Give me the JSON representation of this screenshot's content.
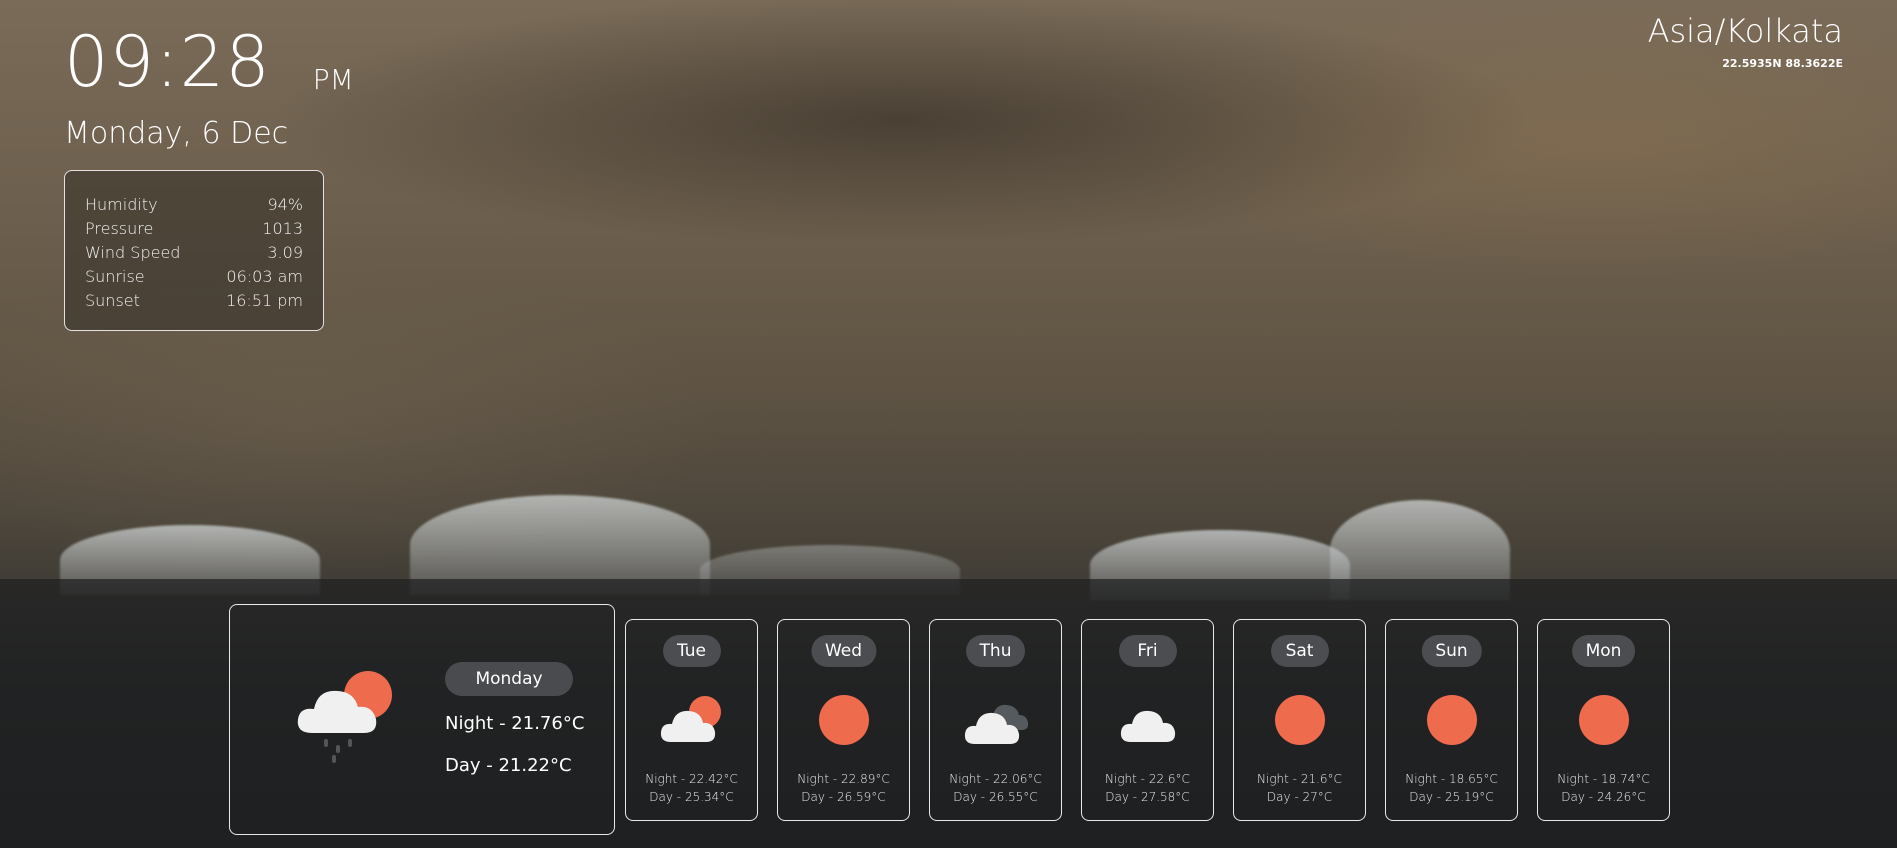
{
  "clock": {
    "time": "09:28",
    "ampm": "PM",
    "date": "Monday, 6 Dec"
  },
  "location": {
    "timezone": "Asia/Kolkata",
    "coords": "22.5935N 88.3622E"
  },
  "details": [
    {
      "label": "Humidity",
      "value": "94%"
    },
    {
      "label": "Pressure",
      "value": "1013"
    },
    {
      "label": "Wind Speed",
      "value": "3.09"
    },
    {
      "label": "Sunrise",
      "value": "06:03 am"
    },
    {
      "label": "Sunset",
      "value": "16:51 pm"
    }
  ],
  "today": {
    "day": "Monday",
    "night": "Night - 21.76°C",
    "day_temp": "Day - 21.22°C",
    "icon": "rain-cloud-sun-icon"
  },
  "forecast": [
    {
      "day": "Tue",
      "night": "Night - 22.42°C",
      "day_temp": "Day - 25.34°C",
      "icon": "partly-cloudy-icon"
    },
    {
      "day": "Wed",
      "night": "Night - 22.89°C",
      "day_temp": "Day - 26.59°C",
      "icon": "sun-icon"
    },
    {
      "day": "Thu",
      "night": "Night - 22.06°C",
      "day_temp": "Day - 26.55°C",
      "icon": "clouds-icon"
    },
    {
      "day": "Fri",
      "night": "Night - 22.6°C",
      "day_temp": "Day - 27.58°C",
      "icon": "cloud-icon"
    },
    {
      "day": "Sat",
      "night": "Night - 21.6°C",
      "day_temp": "Day - 27°C",
      "icon": "sun-icon"
    },
    {
      "day": "Sun",
      "night": "Night - 18.65°C",
      "day_temp": "Day - 25.19°C",
      "icon": "sun-icon"
    },
    {
      "day": "Mon",
      "night": "Night - 18.74°C",
      "day_temp": "Day - 24.26°C",
      "icon": "sun-icon"
    }
  ],
  "colors": {
    "sun": "#ee6b4d",
    "cloud": "#f0f0f0",
    "pill": "#505256"
  }
}
